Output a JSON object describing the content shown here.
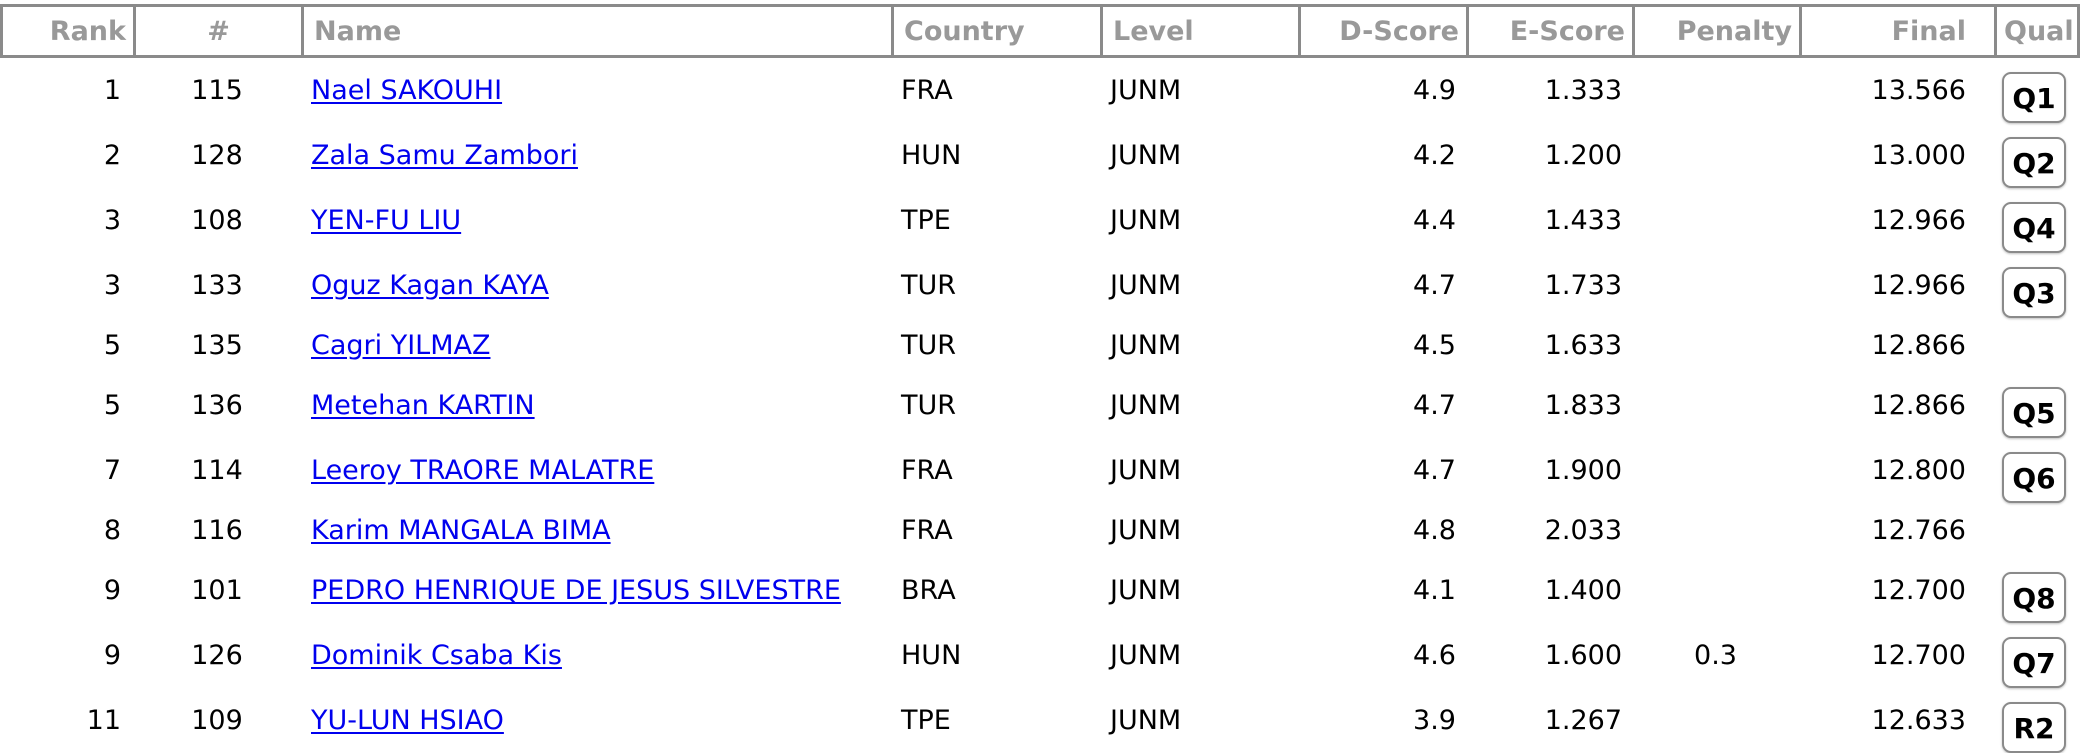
{
  "columns": {
    "rank": "Rank",
    "num": "#",
    "name": "Name",
    "country": "Country",
    "level": "Level",
    "dscore": "D-Score",
    "escore": "E-Score",
    "penalty": "Penalty",
    "final": "Final",
    "qual": "Qual"
  },
  "colors": {
    "header_text": "#999999",
    "border": "#8a8a8a",
    "link": "#0000ee",
    "background": "#ffffff"
  },
  "rows": [
    {
      "rank": "1",
      "num": "115",
      "name": "Nael SAKOUHI",
      "country": "FRA",
      "level": "JUNM",
      "dscore": "4.9",
      "escore": "1.333",
      "penalty": "",
      "final": "13.566",
      "qual": "Q1"
    },
    {
      "rank": "2",
      "num": "128",
      "name": "Zala Samu Zambori",
      "country": "HUN",
      "level": "JUNM",
      "dscore": "4.2",
      "escore": "1.200",
      "penalty": "",
      "final": "13.000",
      "qual": "Q2"
    },
    {
      "rank": "3",
      "num": "108",
      "name": "YEN-FU LIU",
      "country": "TPE",
      "level": "JUNM",
      "dscore": "4.4",
      "escore": "1.433",
      "penalty": "",
      "final": "12.966",
      "qual": "Q4"
    },
    {
      "rank": "3",
      "num": "133",
      "name": "Oguz Kagan KAYA",
      "country": "TUR",
      "level": "JUNM",
      "dscore": "4.7",
      "escore": "1.733",
      "penalty": "",
      "final": "12.966",
      "qual": "Q3"
    },
    {
      "rank": "5",
      "num": "135",
      "name": "Cagri YILMAZ",
      "country": "TUR",
      "level": "JUNM",
      "dscore": "4.5",
      "escore": "1.633",
      "penalty": "",
      "final": "12.866",
      "qual": ""
    },
    {
      "rank": "5",
      "num": "136",
      "name": "Metehan KARTIN",
      "country": "TUR",
      "level": "JUNM",
      "dscore": "4.7",
      "escore": "1.833",
      "penalty": "",
      "final": "12.866",
      "qual": "Q5"
    },
    {
      "rank": "7",
      "num": "114",
      "name": "Leeroy TRAORE MALATRE",
      "country": "FRA",
      "level": "JUNM",
      "dscore": "4.7",
      "escore": "1.900",
      "penalty": "",
      "final": "12.800",
      "qual": "Q6"
    },
    {
      "rank": "8",
      "num": "116",
      "name": "Karim MANGALA BIMA",
      "country": "FRA",
      "level": "JUNM",
      "dscore": "4.8",
      "escore": "2.033",
      "penalty": "",
      "final": "12.766",
      "qual": ""
    },
    {
      "rank": "9",
      "num": "101",
      "name": "PEDRO HENRIQUE DE JESUS SILVESTRE",
      "country": "BRA",
      "level": "JUNM",
      "dscore": "4.1",
      "escore": "1.400",
      "penalty": "",
      "final": "12.700",
      "qual": "Q8"
    },
    {
      "rank": "9",
      "num": "126",
      "name": "Dominik Csaba Kis",
      "country": "HUN",
      "level": "JUNM",
      "dscore": "4.6",
      "escore": "1.600",
      "penalty": "0.3",
      "final": "12.700",
      "qual": "Q7"
    },
    {
      "rank": "11",
      "num": "109",
      "name": "YU-LUN HSIAO",
      "country": "TPE",
      "level": "JUNM",
      "dscore": "3.9",
      "escore": "1.267",
      "penalty": "",
      "final": "12.633",
      "qual": "R2"
    }
  ]
}
